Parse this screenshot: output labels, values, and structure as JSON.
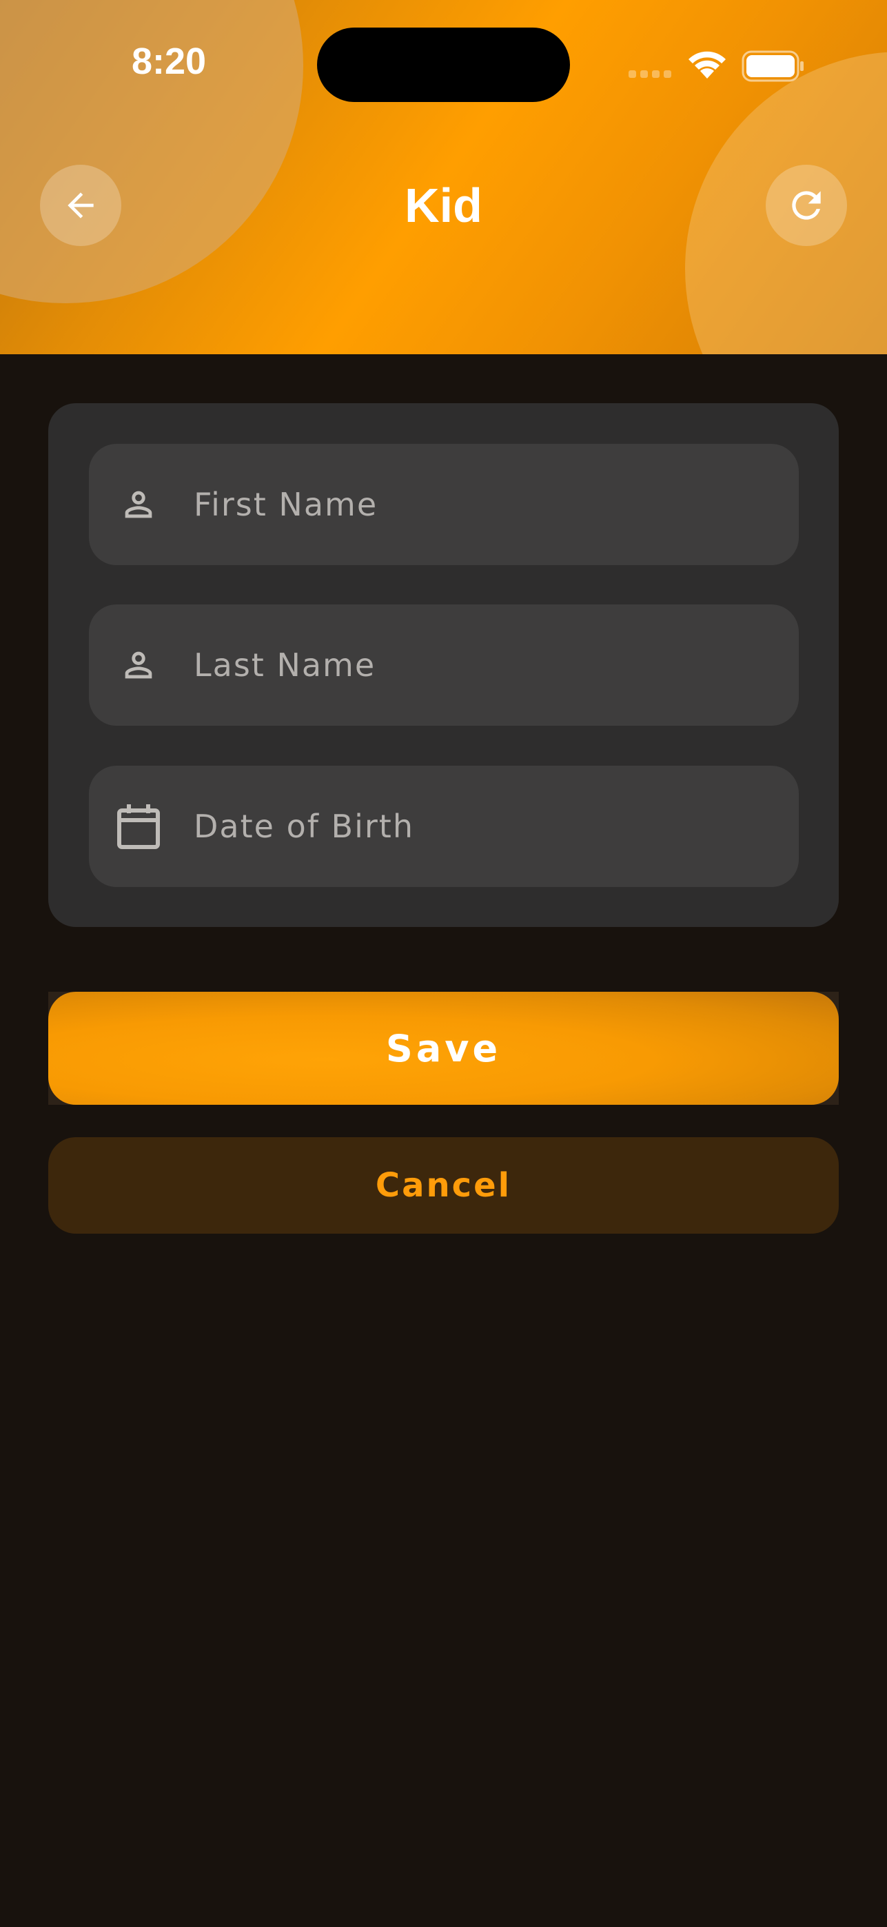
{
  "status_bar": {
    "time": "8:20",
    "icons": [
      "signal-dots-icon",
      "wifi-icon",
      "battery-icon"
    ]
  },
  "header": {
    "title": "Kid",
    "back_icon": "arrow-left-icon",
    "refresh_icon": "refresh-icon"
  },
  "form": {
    "first_name": {
      "placeholder": "First Name",
      "value": "",
      "icon": "person-icon"
    },
    "last_name": {
      "placeholder": "Last Name",
      "value": "",
      "icon": "person-icon"
    },
    "date_of_birth": {
      "placeholder": "Date of Birth",
      "value": "",
      "icon": "calendar-icon"
    }
  },
  "actions": {
    "save_label": "Save",
    "cancel_label": "Cancel"
  },
  "colors": {
    "accent": "#FF9E00",
    "background": "#18120D",
    "card": "#2E2D2D",
    "field": "#3E3D3D",
    "cancel_bg": "#3D270C"
  }
}
